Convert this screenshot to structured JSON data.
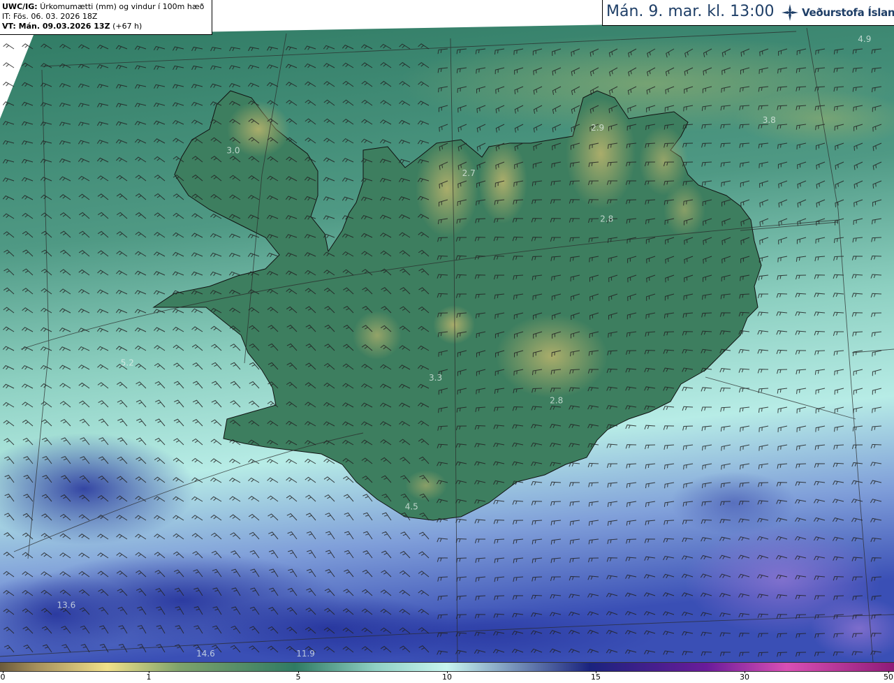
{
  "info": {
    "product": "UWC/IG:",
    "description": "Úrkomumætti (mm) og vindur í 100m hæð",
    "issue_time": "IT: Fös. 06. 03. 2026 18Z",
    "valid_prefix": "VT: Mán. 09.03.2026 13Z",
    "lead_time": "(+67 h)"
  },
  "header": {
    "title": "Mán. 9. mar. kl. 13:00",
    "logo_text": "Veðurstofa Íslands"
  },
  "colorbar": {
    "ticks": [
      "0",
      "1",
      "5",
      "10",
      "15",
      "30",
      "50"
    ],
    "colors": [
      "#6b5a3c",
      "#a58f5c",
      "#f0e08a",
      "#7fa36c",
      "#2f7a63",
      "#8fd0c4",
      "#c8f5ef",
      "#1a237e",
      "#6a1b9a",
      "#d94fb5",
      "#8e1b78"
    ]
  },
  "map_labels": [
    {
      "value": "3.0",
      "lon": -22.95,
      "lat": 66.1
    },
    {
      "value": "2.7",
      "lon": -18.6,
      "lat": 65.95
    },
    {
      "value": "2.9",
      "lon": -16.2,
      "lat": 66.25
    },
    {
      "value": "2.8",
      "lon": -16.1,
      "lat": 65.65
    },
    {
      "value": "4.9",
      "lon": -11.0,
      "lat": 67.0
    },
    {
      "value": "3.8",
      "lon": -13.0,
      "lat": 66.3
    },
    {
      "value": "5.2",
      "lon": -24.6,
      "lat": 64.7
    },
    {
      "value": "3.3",
      "lon": -19.2,
      "lat": 64.6
    },
    {
      "value": "2.8",
      "lon": -17.1,
      "lat": 64.45
    },
    {
      "value": "4.5",
      "lon": -19.6,
      "lat": 63.75
    },
    {
      "value": "13.6",
      "lon": -25.3,
      "lat": 63.1
    },
    {
      "value": "11.9",
      "lon": -21.3,
      "lat": 62.6
    },
    {
      "value": "14.6",
      "lon": -22.9,
      "lat": 62.4
    }
  ]
}
